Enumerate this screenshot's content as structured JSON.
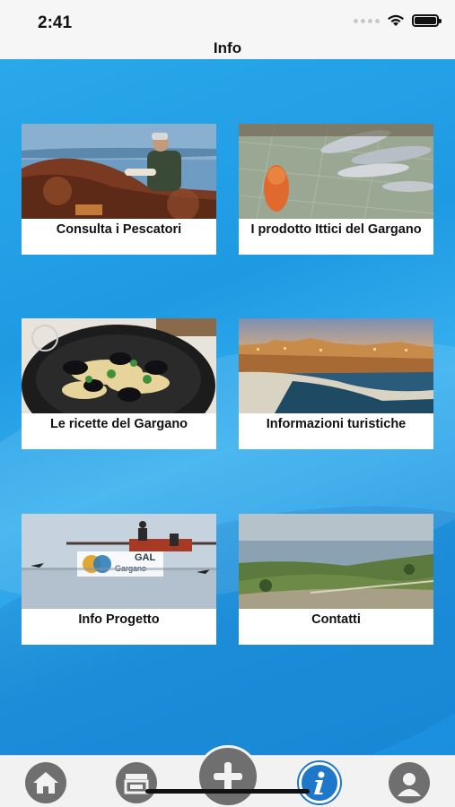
{
  "status_bar": {
    "time": "2:41"
  },
  "nav": {
    "title": "Info"
  },
  "cards": [
    {
      "label": "Consulta i Pescatori",
      "image": "fisherman-nets-photo"
    },
    {
      "label": "I prodotto Ittici del Gargano",
      "image": "fish-catch-photo"
    },
    {
      "label": "Le ricette del Gargano",
      "image": "mussels-pasta-photo"
    },
    {
      "label": "Informazioni turistiche",
      "image": "coastal-town-photo"
    },
    {
      "label": "Info Progetto",
      "image": "gal-gargano-trabucco-photo"
    },
    {
      "label": "Contatti",
      "image": "coastal-landscape-photo"
    }
  ],
  "logo_text": {
    "line1": "GAL",
    "line2": "Gargano"
  },
  "tab_bar": {
    "items": [
      {
        "icon": "home-icon"
      },
      {
        "icon": "shop-icon"
      },
      {
        "icon": "plus-icon"
      },
      {
        "icon": "info-icon",
        "active": true
      },
      {
        "icon": "user-icon"
      }
    ]
  },
  "colors": {
    "accent": "#1e77c9",
    "background": "#2aa8ea",
    "tab_icon": "#6f6f6f"
  }
}
